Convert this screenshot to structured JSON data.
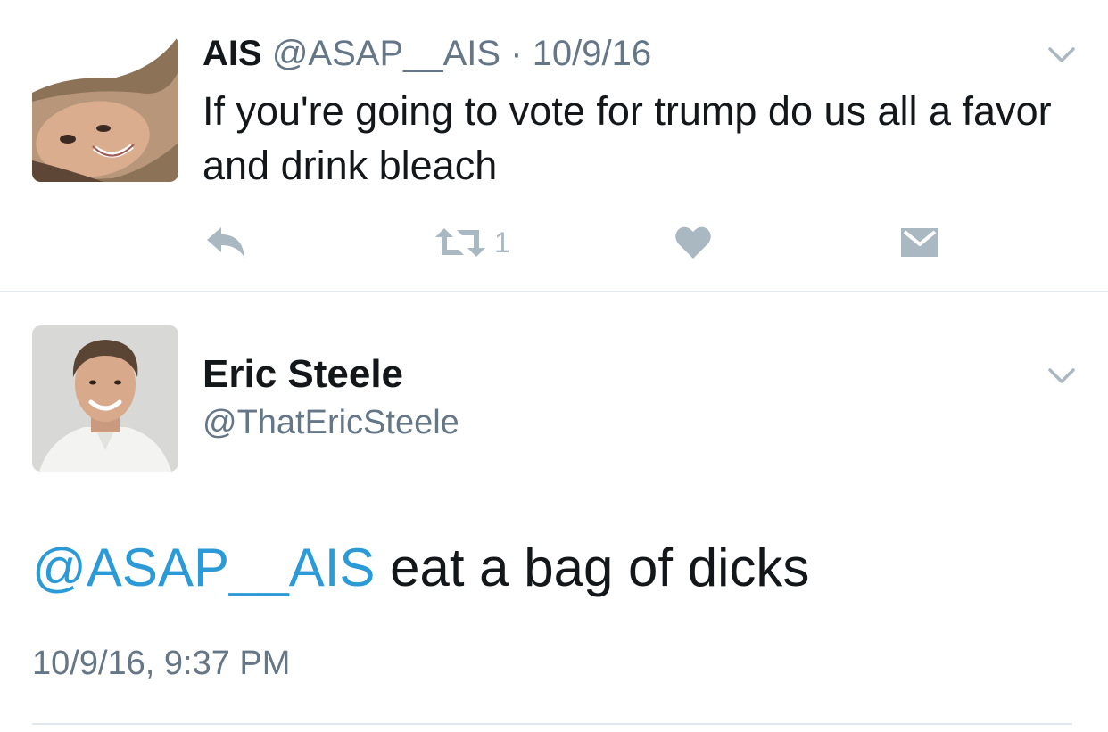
{
  "tweets": [
    {
      "display_name": "AIS",
      "handle": "@ASAP__AIS",
      "separator": "·",
      "date": "10/9/16",
      "text": "If you're going to vote for trump do us all a favor and drink bleach",
      "retweet_count": "1",
      "avatar_icon": "woman-selfie-avatar"
    },
    {
      "display_name": "Eric Steele",
      "handle": "@ThatEricSteele",
      "mention": "@ASAP__AIS",
      "text": " eat a bag of dicks",
      "timestamp": "10/9/16, 9:37 PM",
      "avatar_icon": "man-portrait-avatar"
    }
  ],
  "icons": {
    "reply": "reply-icon",
    "retweet": "retweet-icon",
    "like": "heart-icon",
    "dm": "envelope-icon",
    "menu": "chevron-down-icon"
  },
  "colors": {
    "text": "#14171a",
    "secondary": "#657786",
    "action_gray": "#aab8c2",
    "link_blue": "#2b9ad6",
    "divider": "#e1e8ed"
  }
}
